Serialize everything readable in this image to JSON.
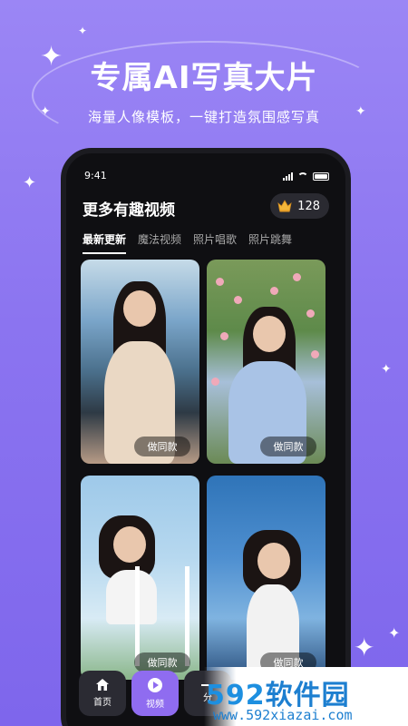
{
  "promo": {
    "title": "专属AI写真大片",
    "subtitle": "海量人像模板，一键打造氛围感写真"
  },
  "status_bar": {
    "time": "9:41"
  },
  "app": {
    "title": "更多有趣视频",
    "coins": "128",
    "crown_icon": "crown-icon"
  },
  "tabs": [
    {
      "label": "最新更新",
      "active": true
    },
    {
      "label": "魔法视频",
      "active": false
    },
    {
      "label": "照片唱歌",
      "active": false
    },
    {
      "label": "照片跳舞",
      "active": false
    }
  ],
  "cards": [
    {
      "button": "做同款"
    },
    {
      "button": "做同款"
    },
    {
      "button": "做同款"
    },
    {
      "button": "做同款"
    }
  ],
  "bottom_nav": [
    {
      "label": "首页",
      "icon": "home-icon",
      "active": false
    },
    {
      "label": "视频",
      "icon": "play-icon",
      "active": true
    },
    {
      "label": "分",
      "icon": "share-icon",
      "active": false
    }
  ],
  "watermark": {
    "logo_num": "592",
    "logo_text": "软件园",
    "url": "www.592xiazai.com"
  },
  "colors": {
    "background": "#8b74f0",
    "accent": "#8f6cf0",
    "phone": "#0f0f12",
    "watermark_blue": "#1d7fd0"
  }
}
